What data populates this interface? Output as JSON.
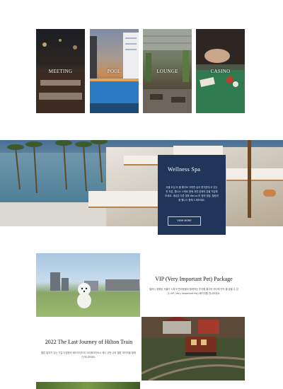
{
  "facilities": [
    {
      "label": "MEETING"
    },
    {
      "label": "POOL"
    },
    {
      "label": "LOUNGE"
    },
    {
      "label": "CASINO"
    }
  ],
  "spa": {
    "title": "Wellness Spa",
    "description": "서울 도심 속 쿨 웨이브 가지만 숨속 한가운데 서 있는 듯 차분, 웰니스 스파로 함께 자연 본래의 온을 직감해보세요. 세상은 다른 엄마 Wel-ss 머 정의 정답, 힐링과함 웰니스 함께 느껴보세요.",
    "button_label": "VIEW MORE"
  },
  "vip": {
    "title": "VIP (Very Important Pet) Package",
    "description": "펄러니 정용된 서울가 스파의 반려동물과 함께하는 투어를 즐기와 어디에 먼저 즐 얼을 수 있는 VIP (Very Important Pet) 패키지를 만나보세요."
  },
  "train": {
    "title": "2022 The Last Journey of Hilton Train",
    "description": "힐튼 열차가 있는 기일 다양한러 레드라이드와 크리에이티브시 레스 사만 나라 힐튼 마지막을 함께 가 떠나보세요."
  }
}
